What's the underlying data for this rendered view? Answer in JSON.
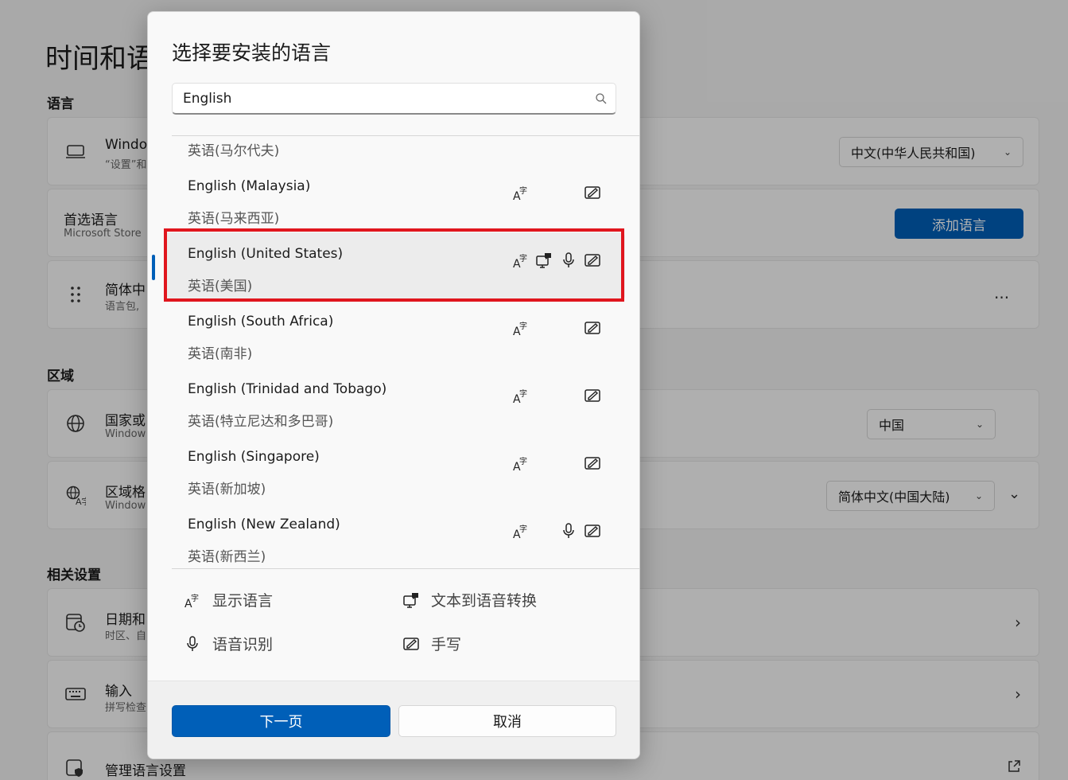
{
  "background": {
    "page_title": "时间和语",
    "language_section": "语言",
    "windows_display": {
      "title": "Windo",
      "subtitle": "“设置”和",
      "dropdown": "中文(中华人民共和国)"
    },
    "preferred": {
      "title": "首选语言",
      "subtitle": "Microsoft Store",
      "button": "添加语言"
    },
    "chinese_item": {
      "title": "简体中",
      "subtitle": "语言包,",
      "more": "..."
    },
    "region_section": "区域",
    "country": {
      "title": "国家或",
      "subtitle": "Window",
      "dropdown": "中国"
    },
    "regional_format": {
      "title": "区域格",
      "subtitle": "Window",
      "dropdown": "简体中文(中国大陆)"
    },
    "related_section": "相关设置",
    "date_time": {
      "title": "日期和",
      "subtitle": "时区、自"
    },
    "typing": {
      "title": "输入",
      "subtitle": "拼写检查"
    },
    "admin_language": {
      "title": "管理语言设置"
    }
  },
  "dialog": {
    "title": "选择要安装的语言",
    "search": {
      "value": "English",
      "placeholder": ""
    },
    "languages": [
      {
        "name": "",
        "native": "英语(马尔代夫)",
        "features": []
      },
      {
        "name": "English (Malaysia)",
        "native": "英语(马来西亚)",
        "features": [
          "display-language",
          "handwriting"
        ]
      },
      {
        "name": "English (United States)",
        "native": "英语(美国)",
        "features": [
          "display-language",
          "text-to-speech",
          "speech-recognition",
          "handwriting"
        ],
        "selected": true
      },
      {
        "name": "English (South Africa)",
        "native": "英语(南非)",
        "features": [
          "display-language",
          "handwriting"
        ]
      },
      {
        "name": "English (Trinidad and Tobago)",
        "native": "英语(特立尼达和多巴哥)",
        "features": [
          "display-language",
          "handwriting"
        ]
      },
      {
        "name": "English (Singapore)",
        "native": "英语(新加坡)",
        "features": [
          "display-language",
          "handwriting"
        ]
      },
      {
        "name": "English (New Zealand)",
        "native": "英语(新西兰)",
        "features": [
          "display-language",
          "speech-recognition",
          "handwriting"
        ]
      }
    ],
    "legend": {
      "display_language": "显示语言",
      "text_to_speech": "文本到语音转换",
      "speech_recognition": "语音识别",
      "handwriting": "手写"
    },
    "buttons": {
      "next": "下一页",
      "cancel": "取消"
    }
  },
  "colors": {
    "accent": "#005fb8",
    "highlight": "#e0161e"
  }
}
